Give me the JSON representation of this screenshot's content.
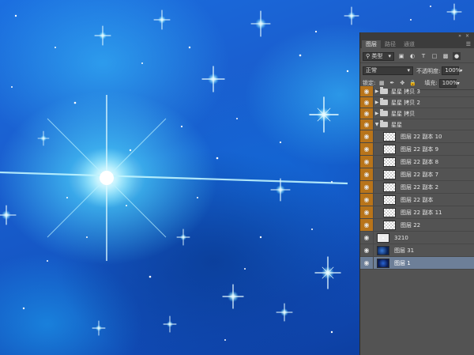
{
  "panel": {
    "tabs": [
      "图层",
      "路径",
      "通道"
    ],
    "filter": {
      "kind_label": "类型"
    },
    "blend": {
      "mode": "正常",
      "opacity_label": "不透明度:",
      "opacity_value": "100%"
    },
    "lock": {
      "lock_label": "锁定:",
      "fill_label": "填充:",
      "fill_value": "100%"
    },
    "layers": [
      {
        "name": "星星 拷贝 3",
        "type": "group",
        "expanded": false
      },
      {
        "name": "星星 拷贝 2",
        "type": "group",
        "expanded": false
      },
      {
        "name": "星星 拷贝",
        "type": "group",
        "expanded": false
      },
      {
        "name": "星星",
        "type": "group",
        "expanded": true
      },
      {
        "name": "图层 22 副本 10",
        "type": "layer"
      },
      {
        "name": "图层 22 副本 9",
        "type": "layer"
      },
      {
        "name": "图层 22 副本 8",
        "type": "layer"
      },
      {
        "name": "图层 22 副本 7",
        "type": "layer"
      },
      {
        "name": "图层 22 副本 2",
        "type": "layer"
      },
      {
        "name": "图层 22 副本",
        "type": "layer"
      },
      {
        "name": "图层 22 副本 11",
        "type": "layer"
      },
      {
        "name": "图层 22",
        "type": "layer"
      },
      {
        "name": "3210",
        "type": "layer"
      },
      {
        "name": "图层 31",
        "type": "layer"
      },
      {
        "name": "图层 1",
        "type": "layer",
        "selected": true
      }
    ]
  },
  "colors": {
    "panel_bg": "#535353",
    "eye_highlight": "#b8741a",
    "selected_row": "#6d7f98"
  }
}
